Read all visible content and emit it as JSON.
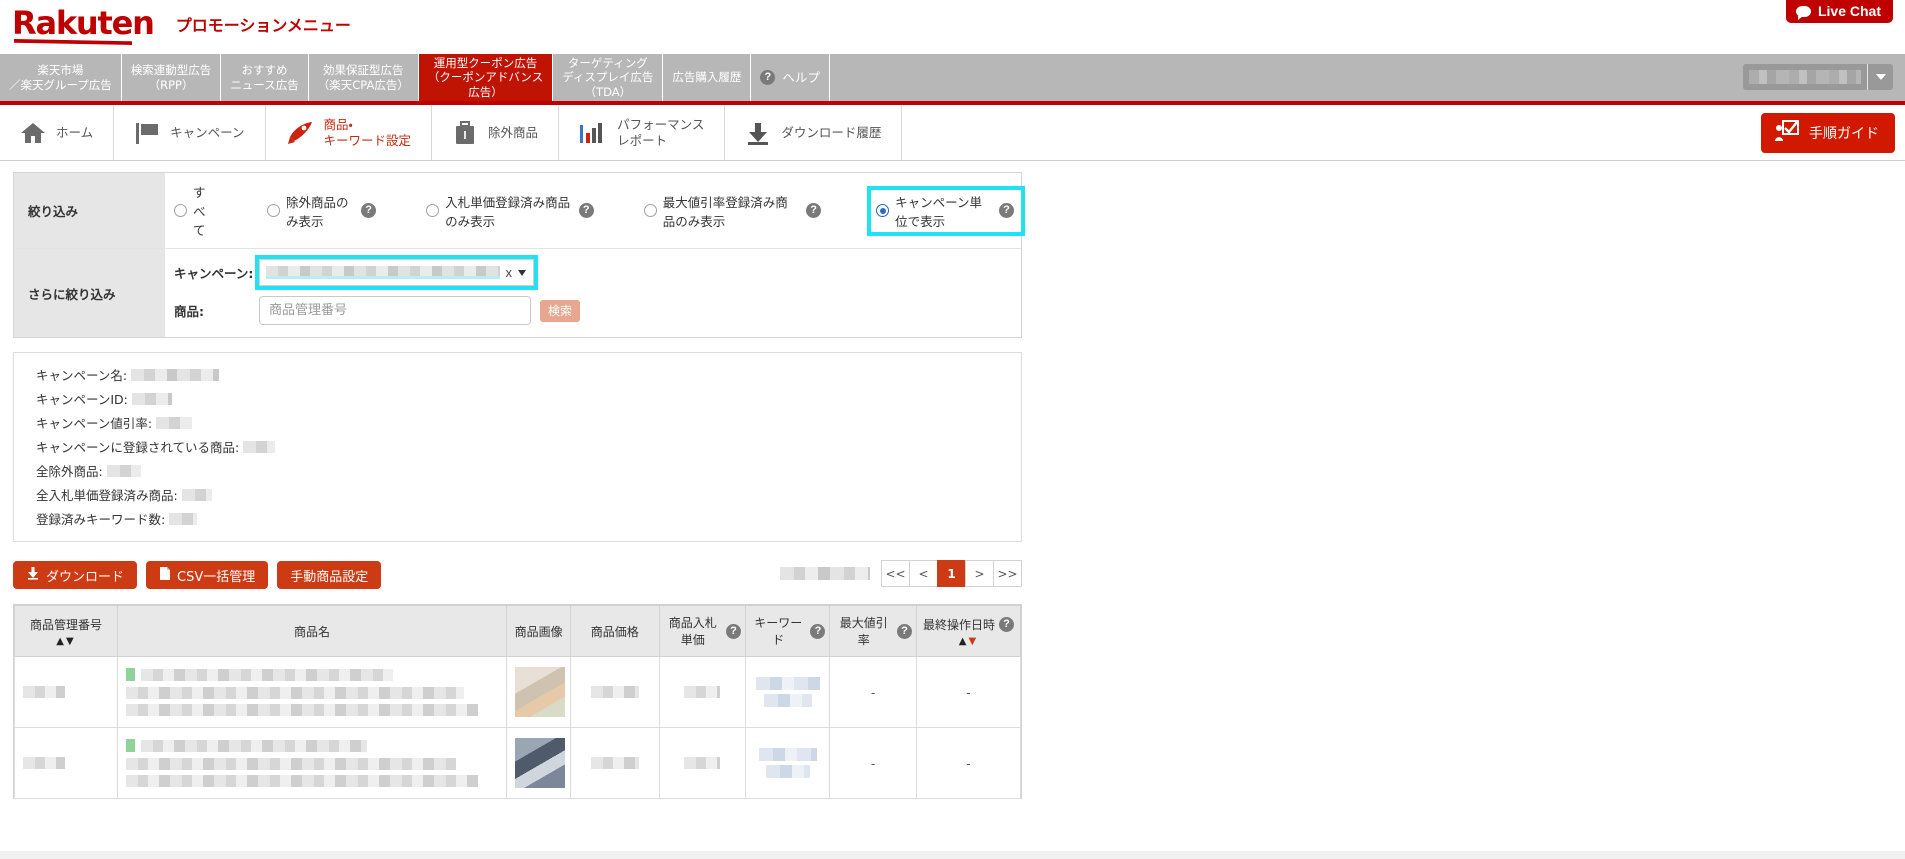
{
  "brand": {
    "logo": "Rakuten",
    "promo_title": "プロモーションメニュー",
    "accent": "#bf0000"
  },
  "live_chat": {
    "label": "Live Chat",
    "icon": "chat-bubble-icon"
  },
  "top_tabs": [
    {
      "label": "楽天市場\n／楽天グループ広告",
      "active": false
    },
    {
      "label": "検索連動型広告\n（RPP）",
      "active": false
    },
    {
      "label": "おすすめ\nニュース広告",
      "active": false
    },
    {
      "label": "効果保証型広告\n（楽天CPA広告）",
      "active": false
    },
    {
      "label": "運用型クーポン広告\n（クーポンアドバンス\n広告）",
      "active": true
    },
    {
      "label": "ターゲティング\nディスプレイ広告\n（TDA）",
      "active": false
    },
    {
      "label": "広告購入履歴",
      "active": false
    },
    {
      "label": "ヘルプ",
      "active": false,
      "icon": "help-question-icon"
    }
  ],
  "account_selector": {
    "value": "",
    "icon": "chevron-down-icon"
  },
  "menu_items": [
    {
      "label": "ホーム",
      "icon": "home-icon",
      "active": false
    },
    {
      "label": "キャンペーン",
      "icon": "flag-icon",
      "active": false
    },
    {
      "label": "商品・\nキーワード設定",
      "icon": "rocket-icon",
      "active": true
    },
    {
      "label": "除外商品",
      "icon": "briefcase-icon",
      "active": false
    },
    {
      "label": "パフォーマンス\nレポート",
      "icon": "bar-chart-icon",
      "active": false
    },
    {
      "label": "ダウンロード履歴",
      "icon": "download-icon",
      "active": false
    }
  ],
  "guide_button": {
    "label": "手順ガイド",
    "icon": "presenter-icon"
  },
  "filters": {
    "row1_label": "絞り込み",
    "row2_label": "さらに絞り込み",
    "radios": [
      {
        "label": "すべて",
        "selected": false,
        "help": false
      },
      {
        "label": "除外商品のみ表示",
        "selected": false,
        "help": true
      },
      {
        "label": "入札単価登録済み商品のみ表示",
        "selected": false,
        "help": true
      },
      {
        "label": "最大値引率登録済み商品のみ表示",
        "selected": false,
        "help": true
      },
      {
        "label": "キャンペーン単位で表示",
        "selected": true,
        "help": true,
        "highlighted": true
      }
    ],
    "campaign_label": "キャンペーン:",
    "campaign_value": "",
    "campaign_clear": "x",
    "item_label": "商品:",
    "item_placeholder": "商品管理番号",
    "search_button": "検索"
  },
  "info_panel": [
    {
      "label": "キャンペーン名:",
      "mask_width": 88
    },
    {
      "label": "キャンペーンID:",
      "mask_width": 40
    },
    {
      "label": "キャンペーン値引率:",
      "mask_width": 36
    },
    {
      "label": "キャンペーンに登録されている商品:",
      "mask_width": 32
    },
    {
      "label": "全除外商品:",
      "mask_width": 34
    },
    {
      "label": "全入札単価登録済み商品:",
      "mask_width": 30
    },
    {
      "label": "登録済みキーワード数:",
      "mask_width": 28
    }
  ],
  "actions": {
    "download": "ダウンロード",
    "csv_bulk": "CSV一括管理",
    "manual_item": "手動商品設定"
  },
  "pagination": {
    "first": "<<",
    "prev": "<",
    "pages": [
      "1"
    ],
    "current": "1",
    "next": ">",
    "last": ">>"
  },
  "table": {
    "columns": [
      {
        "label": "商品管理番号",
        "sort": true,
        "help": false
      },
      {
        "label": "商品名",
        "sort": false,
        "help": false
      },
      {
        "label": "商品画像",
        "sort": false,
        "help": false
      },
      {
        "label": "商品価格",
        "sort": false,
        "help": false
      },
      {
        "label": "商品入札単価",
        "sort": false,
        "help": true
      },
      {
        "label": "キーワード",
        "sort": false,
        "help": true
      },
      {
        "label": "最大値引率",
        "sort": false,
        "help": true
      },
      {
        "label": "最終操作日時",
        "sort": true,
        "help": true
      }
    ],
    "rows": [
      {
        "max_discount": "-",
        "last_op": "-",
        "thumb": "a"
      },
      {
        "max_discount": "-",
        "last_op": "-",
        "thumb": "b"
      }
    ]
  }
}
